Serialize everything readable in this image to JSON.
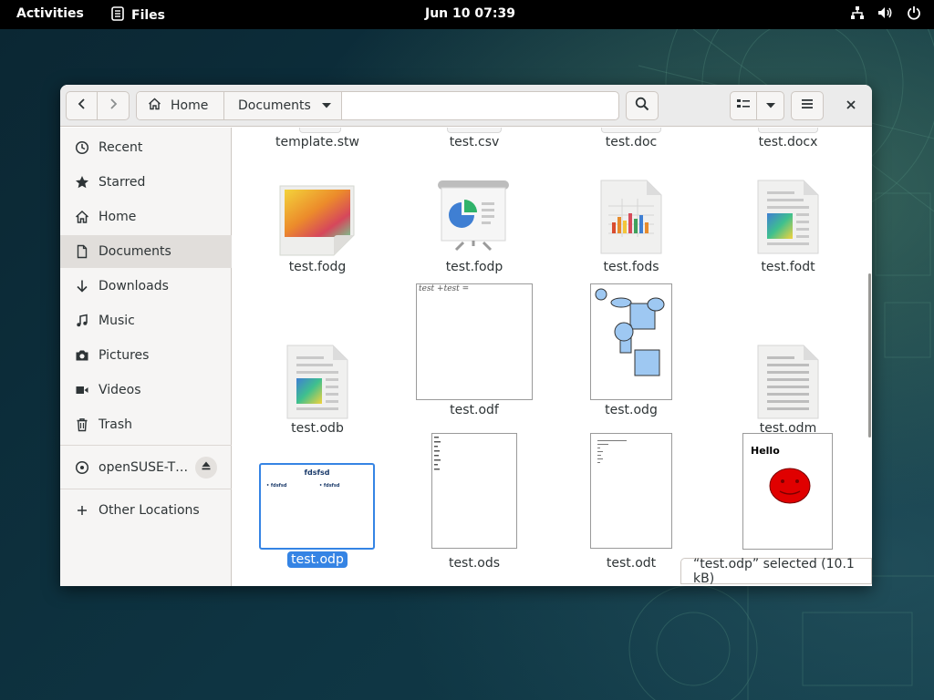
{
  "topbar": {
    "activities": "Activities",
    "app_name": "Files",
    "clock": "Jun 10  07:39",
    "status_icons": [
      "network-icon",
      "volume-icon",
      "power-icon"
    ]
  },
  "headerbar": {
    "back_icon": "chevron-left-icon",
    "forward_icon": "chevron-right-icon",
    "breadcrumbs": [
      "Home",
      "Documents"
    ],
    "search_icon": "search-icon",
    "view_icons": [
      "list-view-icon",
      "chevron-down-icon",
      "menu-icon"
    ],
    "close_icon": "close-icon"
  },
  "sidebar": {
    "items": [
      {
        "label": "Recent",
        "icon": "clock-icon"
      },
      {
        "label": "Starred",
        "icon": "star-icon"
      },
      {
        "label": "Home",
        "icon": "home-icon"
      },
      {
        "label": "Documents",
        "icon": "document-icon",
        "active": true
      },
      {
        "label": "Downloads",
        "icon": "download-icon"
      },
      {
        "label": "Music",
        "icon": "music-icon"
      },
      {
        "label": "Pictures",
        "icon": "camera-icon"
      },
      {
        "label": "Videos",
        "icon": "video-icon"
      },
      {
        "label": "Trash",
        "icon": "trash-icon"
      }
    ],
    "volume": {
      "label": "openSUSE-T…",
      "icon": "disc-icon",
      "eject_icon": "eject-icon"
    },
    "other_locations": {
      "label": "Other Locations",
      "icon": "plus-icon"
    }
  },
  "files": {
    "row0": [
      "template.stw",
      "test.csv",
      "test.doc",
      "test.docx"
    ],
    "row1": [
      "test.fodg",
      "test.fodp",
      "test.fods",
      "test.fodt"
    ],
    "row2": [
      "test.odb",
      "test.odf",
      "test.odg",
      "test.odm"
    ],
    "row3": [
      "test.odp",
      "test.ods",
      "test.odt",
      ""
    ],
    "selected": "test.odp",
    "thumb_text": {
      "odf_formula": "test +test =",
      "odp_title": "fdsfsd",
      "odp_bullet1": "• fdsfsd",
      "odp_bullet2": "• fdsfsd",
      "hello": "Hello"
    }
  },
  "status": {
    "text": "“test.odp” selected  (10.1 kB)"
  },
  "colors": {
    "selection": "#3584e4",
    "sidebar_bg": "#f6f5f4",
    "active_item": "#e1dedb",
    "topbar": "#000000"
  }
}
